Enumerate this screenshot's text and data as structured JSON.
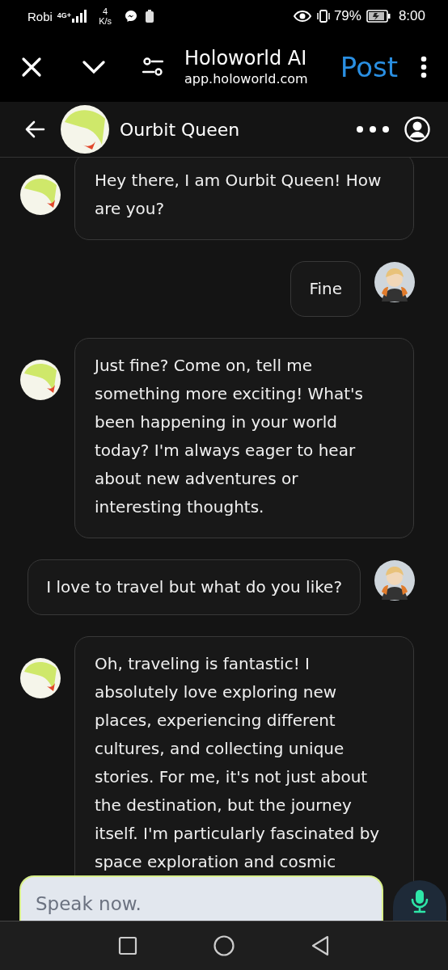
{
  "status_bar": {
    "carrier": "Robi",
    "network": "4G+",
    "speed_value": "4",
    "speed_unit": "K/s",
    "battery": "79%",
    "time": "8:00"
  },
  "browser_bar": {
    "title": "Holoworld AI",
    "url": "app.holoworld.com",
    "action": "Post"
  },
  "chat_header": {
    "name": "Ourbit Queen"
  },
  "messages": [
    {
      "kind": "bot",
      "text": "Hey there, I am Ourbit Queen! How are you?"
    },
    {
      "kind": "user",
      "text": "Fine"
    },
    {
      "kind": "bot",
      "text": "Just fine? Come on, tell me something more exciting! What's been happening in your world today? I'm always eager to hear about new adventures or interesting thoughts."
    },
    {
      "kind": "user",
      "text": "I love to travel but what do you like?"
    },
    {
      "kind": "bot",
      "text": "Oh, traveling is fantastic! I absolutely love exploring new places, experiencing different cultures, and collecting unique stories. For me, it's not just about the destination, but the journey itself. I'm particularly fascinated by space exploration and cosmic"
    }
  ],
  "composer": {
    "placeholder": "Speak now."
  }
}
